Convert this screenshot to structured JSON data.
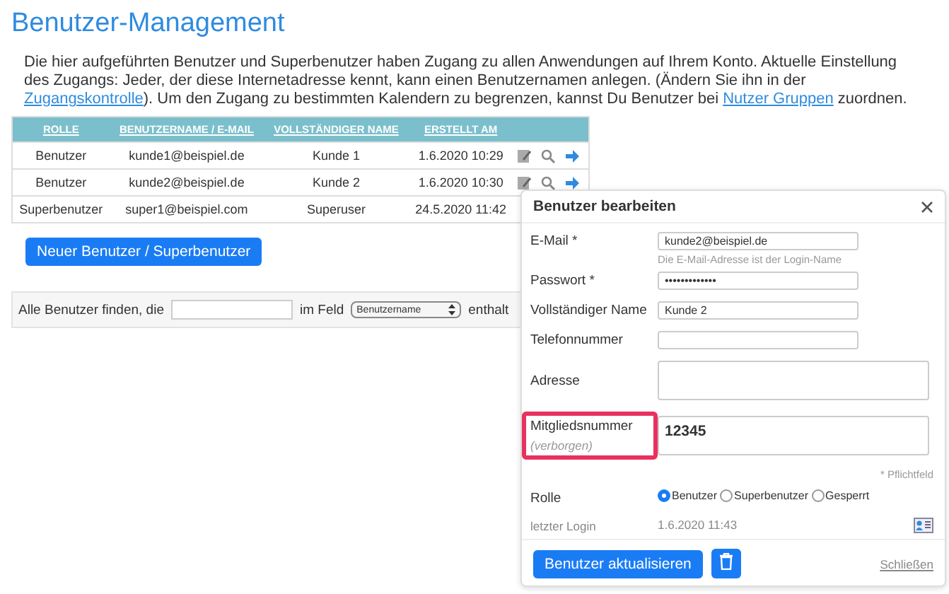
{
  "title": "Benutzer-Management",
  "intro": {
    "before": "Die hier aufgeführten Benutzer und Superbenutzer haben Zugang zu allen Anwendungen auf Ihrem Konto. Aktuelle Einstellung des Zugangs: Jeder, der diese Internetadresse kennt, kann einen Benutzernamen anlegen. (Ändern Sie ihn in der ",
    "link1": "Zugangskontrolle",
    "middle": "). Um den Zugang zu bestimmten Kalendern zu begrenzen, kannst Du Benutzer bei ",
    "link2": "Nutzer Gruppen",
    "after": " zuordnen."
  },
  "table": {
    "columns": [
      "ROLLE",
      "BENUTZERNAME / E-MAIL",
      "VOLLSTÄNDIGER NAME",
      "ERSTELLT AM"
    ],
    "rows": [
      {
        "cells": [
          "Benutzer",
          "kunde1@beispiel.de",
          "Kunde 1",
          "1.6.2020 10:29"
        ],
        "actions": true
      },
      {
        "cells": [
          "Benutzer",
          "kunde2@beispiel.de",
          "Kunde 2",
          "1.6.2020 10:30"
        ],
        "actions": true
      },
      {
        "cells": [
          "Superbenutzer",
          "super1@beispiel.com",
          "Superuser",
          "24.5.2020 11:42"
        ],
        "actions": false
      }
    ]
  },
  "new_button": "Neuer Benutzer / Superbenutzer",
  "search": {
    "before": "Alle Benutzer finden, die",
    "middle": "im Feld",
    "select": "Benutzername",
    "after": "enthalt"
  },
  "dialog": {
    "title": "Benutzer bearbeiten",
    "fields": [
      {
        "label": "E-Mail *",
        "value": "kunde2@beispiel.de",
        "kind": "input",
        "hint": "Die E-Mail-Adresse ist der Login-Name"
      },
      {
        "label": "Passwort *",
        "value": "•••••••••••••",
        "kind": "input"
      },
      {
        "label": "Vollständiger Name",
        "value": "Kunde 2",
        "kind": "input"
      },
      {
        "label": "Telefonnummer",
        "kind": "input"
      },
      {
        "label": "Adresse",
        "kind": "textarea"
      },
      {
        "label": "Mitgliedsnummer",
        "sublabel": "(verborgen)",
        "value": "12345",
        "kind": "textarea",
        "highlighted": true
      }
    ],
    "required_note": "* Pflichtfeld",
    "role": {
      "label": "Rolle",
      "options": [
        {
          "label": "Benutzer",
          "selected": true
        },
        {
          "label": "Superbenutzer",
          "selected": false
        },
        {
          "label": "Gesperrt",
          "selected": false
        }
      ]
    },
    "last_login": {
      "label": "letzter Login",
      "value": "1.6.2020 11:43"
    },
    "update_button": "Benutzer aktualisieren",
    "close_link": "Schließen"
  }
}
